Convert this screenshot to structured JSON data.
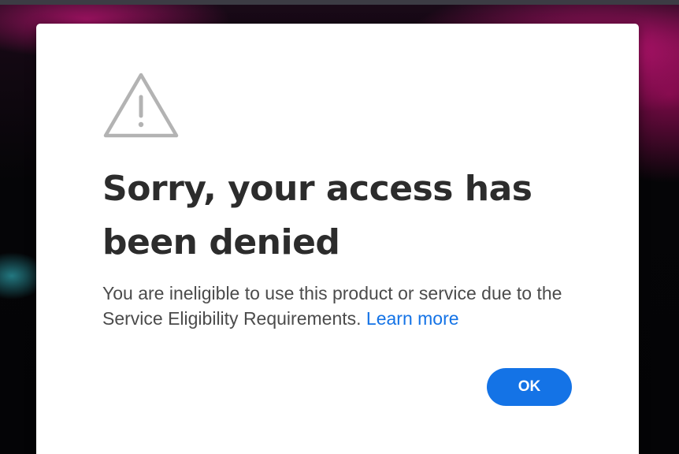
{
  "dialog": {
    "icon": "alert-triangle-icon",
    "title": "Sorry, your access has been denied",
    "message": "You are ineligible to use this product or service due to the Service Eligibility Requirements.",
    "learn_more_label": "Learn more",
    "ok_label": "OK"
  },
  "colors": {
    "accent": "#1473e6",
    "title": "#2c2c2c",
    "body": "#4b4b4b",
    "icon": "#b3b3b3"
  }
}
